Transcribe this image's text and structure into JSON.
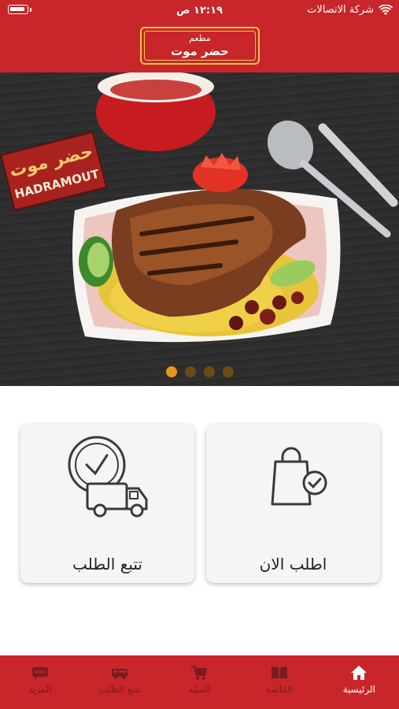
{
  "status_bar": {
    "carrier": "شركة الاتصالات",
    "time": "١٢:١٩ ص"
  },
  "header": {
    "subtitle": "مطعم",
    "title": "حضر موت"
  },
  "hero": {
    "slide_count": 4,
    "active_slide": 0,
    "sign_text_ar": "حضر موت",
    "sign_text_en": "HADRAMOUT"
  },
  "actions": {
    "order_now": "اطلب الان",
    "track_order": "تتبع الطلب"
  },
  "bottom_nav": {
    "items": [
      {
        "label": "الرئيسية",
        "icon": "home-icon",
        "active": true
      },
      {
        "label": "القائمة",
        "icon": "menu-book-icon",
        "active": false
      },
      {
        "label": "السلة",
        "icon": "cart-icon",
        "active": false
      },
      {
        "label": "تتبع الطلب",
        "icon": "truck-icon",
        "active": false
      },
      {
        "label": "المزيد",
        "icon": "more-icon",
        "active": false
      }
    ]
  },
  "colors": {
    "brand_red": "#c8262a",
    "accent_gold": "#f2c74a",
    "dot_active": "#e8951b",
    "dot_inactive": "#6b4a14"
  }
}
